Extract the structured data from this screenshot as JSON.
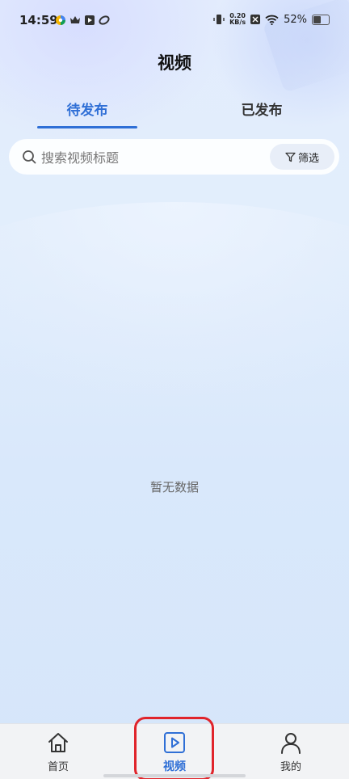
{
  "status_bar": {
    "time": "14:59",
    "net_speed_value": "0.20",
    "net_speed_unit": "KB/s",
    "battery": "52%",
    "battery_level": 0.52,
    "left_icons": [
      "app-icon-colorful",
      "crown-icon",
      "play-store-icon",
      "leaf-icon"
    ],
    "right_icons": [
      "vibrate-icon",
      "nfc-icon",
      "wifi-icon",
      "battery-icon"
    ]
  },
  "header": {
    "title": "视频"
  },
  "tabs": [
    {
      "label": "待发布",
      "active": true
    },
    {
      "label": "已发布",
      "active": false
    }
  ],
  "search": {
    "placeholder": "搜索视频标题",
    "value": "",
    "filter_label": "筛选"
  },
  "empty_state": {
    "text": "暂无数据"
  },
  "bottom_nav": {
    "items": [
      {
        "label": "首页",
        "icon": "home-icon",
        "active": false
      },
      {
        "label": "视频",
        "icon": "play-square-icon",
        "active": true
      },
      {
        "label": "我的",
        "icon": "person-icon",
        "active": false
      }
    ]
  },
  "colors": {
    "accent": "#2f6fd6",
    "highlight": "#e0242b"
  }
}
